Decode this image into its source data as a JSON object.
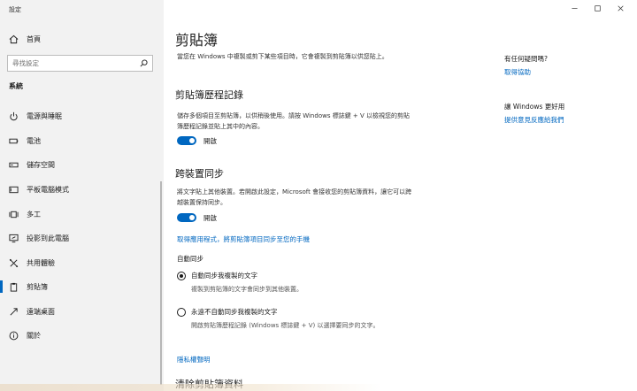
{
  "window": {
    "title": "設定"
  },
  "sidebar": {
    "home_label": "首頁",
    "search_placeholder": "尋找設定",
    "section_label": "系統",
    "items": [
      {
        "label": "電源與睡眠",
        "icon": "power-icon"
      },
      {
        "label": "電池",
        "icon": "battery-icon"
      },
      {
        "label": "儲存空間",
        "icon": "storage-icon"
      },
      {
        "label": "平板電腦模式",
        "icon": "tablet-mode-icon"
      },
      {
        "label": "多工",
        "icon": "multitasking-icon"
      },
      {
        "label": "投影到此電腦",
        "icon": "projecting-icon"
      },
      {
        "label": "共用體驗",
        "icon": "shared-experiences-icon"
      },
      {
        "label": "剪貼簿",
        "icon": "clipboard-icon",
        "selected": true
      },
      {
        "label": "遠端桌面",
        "icon": "remote-desktop-icon"
      },
      {
        "label": "關於",
        "icon": "info-icon"
      }
    ]
  },
  "main": {
    "title": "剪貼簿",
    "intro": "當您在 Windows 中複製或剪下某些項目時，它會複製到剪貼簿以供您貼上。",
    "history": {
      "heading": "剪貼簿歷程記錄",
      "description": "儲存多個項目至剪貼簿，以供稍後使用。請按 Windows 標誌鍵 + V 以檢視您的剪貼簿歷程記錄並貼上其中的內容。",
      "toggle_label": "開啟",
      "toggle_on": true
    },
    "sync": {
      "heading": "跨裝置同步",
      "description": "將文字貼上其他裝置。若開啟此設定，Microsoft 會接收您的剪貼簿資料，讓它可以跨越裝置保持同步。",
      "toggle_label": "開啟",
      "toggle_on": true,
      "link": "取得應用程式，將剪貼簿項目同步至您的手機",
      "auto_sync_label": "自動同步",
      "options": [
        {
          "label": "自動同步我複製的文字",
          "description": "複製到剪貼簿的文字會同步到其他裝置。",
          "checked": true
        },
        {
          "label": "永遠不自動同步我複製的文字",
          "description": "開啟剪貼簿歷程記錄 (Windows 標誌鍵 + V) 以選擇要同步的文字。",
          "checked": false
        }
      ]
    },
    "privacy_link": "隱私權聲明",
    "clear_heading": "清除剪貼簿資料"
  },
  "right_panel": {
    "help_heading": "有任何疑問嗎?",
    "help_link": "取得協助",
    "feedback_heading": "讓 Windows 更好用",
    "feedback_link": "提供意見反應給我們"
  },
  "colors": {
    "accent": "#0067c0",
    "sidebar_bg": "#f2f2f2"
  }
}
